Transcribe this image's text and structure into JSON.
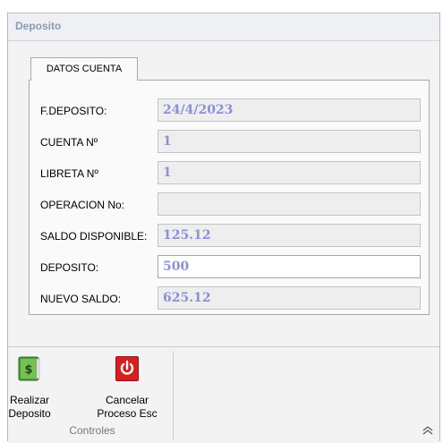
{
  "window": {
    "title": "Deposito"
  },
  "tabs": [
    {
      "label": "DATOS CUENTA"
    }
  ],
  "form": {
    "fields": [
      {
        "label": "F.DEPOSITO:",
        "value": "24/4/2023"
      },
      {
        "label": "CUENTA Nº",
        "value": "1"
      },
      {
        "label": "LIBRETA Nº",
        "value": "1"
      },
      {
        "label": "OPERACION No:",
        "value": ""
      },
      {
        "label": "SALDO DISPONIBLE:",
        "value": "125.12"
      },
      {
        "label": "DEPOSITO:",
        "value": "500"
      },
      {
        "label": "NUEVO SALDO:",
        "value": "625.12"
      }
    ]
  },
  "ribbon": {
    "group_label": "Controles",
    "buttons": [
      {
        "label_line1": "Realizar",
        "label_line2": "Deposito",
        "icon": "money-book-icon"
      },
      {
        "label_line1": "Cancelar",
        "label_line2": "Proceso Esc",
        "icon": "power-icon"
      }
    ]
  },
  "colors": {
    "value_text": "#8b90d8",
    "title_text": "#8a9bb8",
    "deposit_icon": "#4e9a3a",
    "cancel_icon": "#d42020"
  }
}
